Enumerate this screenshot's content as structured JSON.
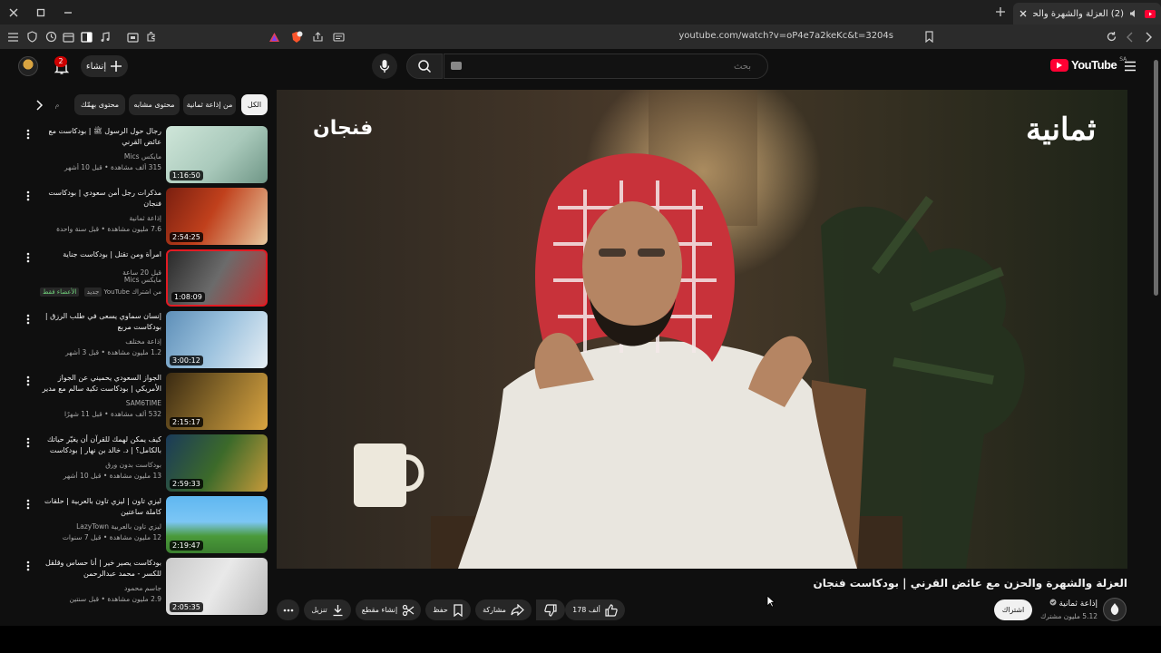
{
  "browser": {
    "tab_title": "(2) العزلة والشهرة والحزن مع عا",
    "url": "youtube.com/watch?v=oP4e7a2keKc&t=3204s"
  },
  "header": {
    "logo_text": "YouTube",
    "country_code": "SA",
    "search_placeholder": "بحث",
    "create_label": "إنشاء",
    "notification_count": "2"
  },
  "chips": [
    "الكل",
    "من إذاعة ثمانية",
    "محتوى مشابه",
    "محتوى بهمّك",
    "م"
  ],
  "recommendations": [
    {
      "title": "رجال حول الرسول ﷺ | بودكاست مع عائض القرني",
      "channel": "مايكس Mics",
      "meta": "315 ألف مشاهدة • قبل 10 أشهر",
      "duration": "1:16:50"
    },
    {
      "title": "مذكرات رجل أمن سعودي | بودكاست فنجان",
      "channel": "إذاعة ثمانية",
      "meta": "7.6 مليون مشاهدة • قبل سنة واحدة",
      "duration": "2:54:25"
    },
    {
      "title": "امرأة ومن تقتل | بودكاست جناية",
      "channel": "مايكس Mics",
      "meta": "قبل 20 ساعة",
      "duration": "1:08:09",
      "badge_new": "جديد",
      "badge_member": "الأعضاء فقط",
      "badge_source": "من اشتراك YouTube"
    },
    {
      "title": "إنسان سماوي يسعى في طلب الرزق | بودكاست مربع",
      "channel": "إذاعة مختلف",
      "meta": "1.2 مليون مشاهدة • قبل 3 أشهر",
      "duration": "3:00:12"
    },
    {
      "title": "الجواز السعودي يحميني عن الجواز الأمريكي | بودكاست تكية سالم مع مدير العالم",
      "channel": "SAM6TIME",
      "meta": "532 ألف مشاهدة • قبل 11 شهرًا",
      "duration": "2:15:17"
    },
    {
      "title": "كيف يمكن لهمك للقرآن أن يغيّر حياتك بالكامل؟ | د. خالد بن نهار | بودكاست بدون...",
      "channel": "بودكاست بدون ورق",
      "meta": "13 مليون مشاهدة • قبل 10 أشهر",
      "duration": "2:59:33"
    },
    {
      "title": "ليزي تاون | ليزي تاون بالعربية | حلقات كاملة ساعتين",
      "channel": "ليزي تاون بالعربية LazyTown",
      "meta": "12 مليون مشاهدة • قبل 7 سنوات",
      "duration": "2:19:47"
    },
    {
      "title": "بودكاست يصير خير | أنا حساس وقلقل للكسر - محمد عبدالرحمن",
      "channel": "جاسم محمود",
      "meta": "2.9 مليون مشاهدة • قبل سنتين",
      "duration": "2:05:35"
    }
  ],
  "player": {
    "brand_right": "ثمانية",
    "brand_left": "فنجان"
  },
  "video": {
    "title": "العزلة والشهرة والحزن مع عائض القرني | بودكاست فنجان",
    "channel_name": "إذاعة ثمانية",
    "subscribers": "5.12 مليون مشترك",
    "subscribe_label": "اشتراك",
    "likes": "178 ألف",
    "share_label": "مشاركة",
    "save_label": "حفظ",
    "clip_label": "إنشاء مقطع",
    "download_label": "تنزيل"
  },
  "colors": {
    "background": "#0f0f0f",
    "accent_red": "#ff0033",
    "chip_bg": "#272727"
  }
}
